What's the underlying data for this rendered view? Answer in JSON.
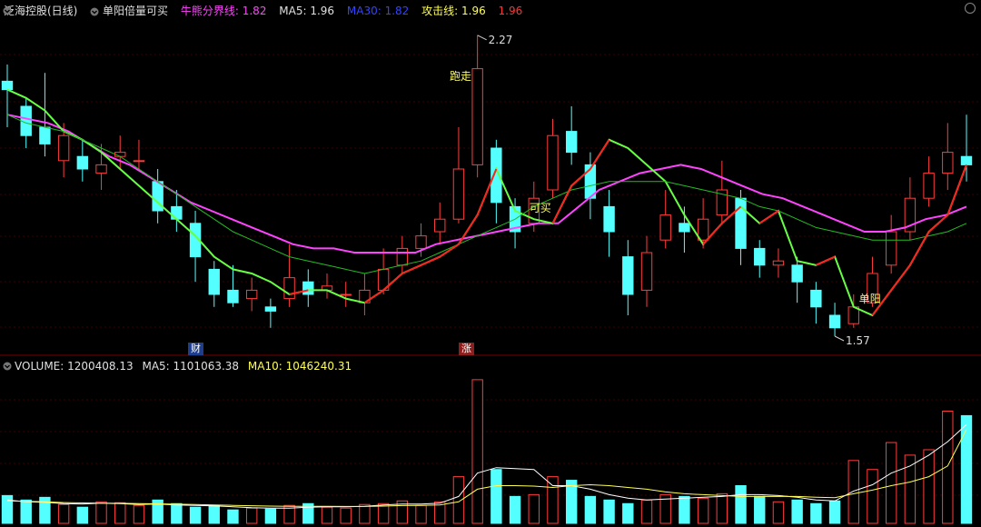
{
  "top_header": {
    "stock_name": "泛海控股(日线)",
    "indicator_name": "单阳倍量可买",
    "line1_label": "牛熊分界线: 1.82",
    "line2_label": "MA5: 1.96",
    "line3_label": "MA30: 1.82",
    "line4_label": "攻击线: 1.96",
    "line5_label": "1.96",
    "colors": {
      "stock": "#e0e0e0",
      "indicator": "#e0e0e0",
      "line1": "#ff44ff",
      "line2": "#e0e0e0",
      "line3": "#3344ff",
      "line4": "#ffff55",
      "line5": "#ff3333"
    }
  },
  "volume_header": {
    "volume_label": "VOLUME: 1200408.13",
    "ma5_label": "MA5: 1101063.38",
    "ma10_label": "MA10: 1046240.31",
    "colors": {
      "volume": "#e0e0e0",
      "ma5": "#e0e0e0",
      "ma10": "#ffff55"
    }
  },
  "annotations": {
    "high_label": "2.27",
    "low_label": "1.57",
    "signal_run": "跑走",
    "signal_buy": "可买",
    "signal_single": "单阳",
    "badge_cai": "财",
    "badge_zhang": "涨"
  },
  "chart_data": {
    "type": "candlestick",
    "price_range": [
      1.55,
      2.3
    ],
    "volume_range": [
      0,
      1700000
    ],
    "series": [
      {
        "name": "牛熊分界线",
        "values": [
          2.08,
          2.07,
          2.06,
          2.04,
          2.01,
          1.98,
          1.96,
          1.93,
          1.9,
          1.87,
          1.85,
          1.83,
          1.81,
          1.79,
          1.77,
          1.76,
          1.76,
          1.75,
          1.75,
          1.75,
          1.75,
          1.77,
          1.78,
          1.79,
          1.8,
          1.81,
          1.82,
          1.82,
          1.86,
          1.9,
          1.92,
          1.94,
          1.95,
          1.96,
          1.95,
          1.93,
          1.91,
          1.89,
          1.88,
          1.86,
          1.84,
          1.82,
          1.8,
          1.8,
          1.81,
          1.83,
          1.84,
          1.86
        ]
      },
      {
        "name": "MA5",
        "values": [
          2.14,
          2.12,
          2.09,
          2.04,
          2.02,
          1.99,
          1.95,
          1.91,
          1.87,
          1.83,
          1.79,
          1.74,
          1.71,
          1.7,
          1.68,
          1.65,
          1.66,
          1.66,
          1.64,
          1.63,
          1.66,
          1.7,
          1.72,
          1.74,
          1.77,
          1.84,
          1.95,
          1.85,
          1.83,
          1.82,
          1.91,
          1.95,
          2.02,
          2.0,
          1.96,
          1.92,
          1.84,
          1.77,
          1.82,
          1.86,
          1.82,
          1.85,
          1.73,
          1.72,
          1.74,
          1.62,
          1.6,
          1.66,
          1.72,
          1.8,
          1.84,
          1.96
        ]
      },
      {
        "name": "MA30",
        "values": [
          2.08,
          2.06,
          2.05,
          2.04,
          2.02,
          2.0,
          1.98,
          1.95,
          1.92,
          1.89,
          1.86,
          1.83,
          1.8,
          1.78,
          1.76,
          1.74,
          1.73,
          1.72,
          1.71,
          1.7,
          1.71,
          1.72,
          1.73,
          1.75,
          1.77,
          1.79,
          1.81,
          1.83,
          1.86,
          1.88,
          1.9,
          1.91,
          1.92,
          1.92,
          1.92,
          1.92,
          1.91,
          1.9,
          1.89,
          1.88,
          1.86,
          1.85,
          1.83,
          1.81,
          1.8,
          1.79,
          1.78,
          1.78,
          1.78,
          1.79,
          1.8,
          1.82
        ]
      }
    ],
    "candles": [
      [
        2.16,
        2.14,
        2.2,
        2.05
      ],
      [
        2.1,
        2.03,
        2.12,
        2.0
      ],
      [
        2.05,
        2.01,
        2.18,
        1.98
      ],
      [
        1.97,
        2.03,
        2.06,
        1.93
      ],
      [
        1.98,
        1.95,
        2.02,
        1.92
      ],
      [
        1.94,
        1.96,
        2.01,
        1.9
      ],
      [
        1.98,
        1.99,
        2.03,
        1.95
      ],
      [
        1.97,
        1.97,
        2.02,
        1.95
      ],
      [
        1.92,
        1.85,
        1.95,
        1.82
      ],
      [
        1.86,
        1.83,
        1.9,
        1.8
      ],
      [
        1.82,
        1.74,
        1.85,
        1.68
      ],
      [
        1.71,
        1.65,
        1.73,
        1.62
      ],
      [
        1.66,
        1.63,
        1.72,
        1.62
      ],
      [
        1.64,
        1.66,
        1.69,
        1.61
      ],
      [
        1.62,
        1.61,
        1.64,
        1.57
      ],
      [
        1.64,
        1.69,
        1.77,
        1.62
      ],
      [
        1.68,
        1.65,
        1.71,
        1.62
      ],
      [
        1.66,
        1.67,
        1.7,
        1.64
      ],
      [
        1.65,
        1.65,
        1.68,
        1.62
      ],
      [
        1.63,
        1.66,
        1.7,
        1.6
      ],
      [
        1.66,
        1.71,
        1.76,
        1.65
      ],
      [
        1.72,
        1.76,
        1.79,
        1.7
      ],
      [
        1.76,
        1.79,
        1.82,
        1.74
      ],
      [
        1.8,
        1.83,
        1.87,
        1.77
      ],
      [
        1.83,
        1.95,
        2.05,
        1.82
      ],
      [
        1.96,
        2.19,
        2.27,
        1.93
      ],
      [
        2.0,
        1.87,
        2.02,
        1.82
      ],
      [
        1.86,
        1.8,
        1.88,
        1.76
      ],
      [
        1.82,
        1.88,
        1.92,
        1.8
      ],
      [
        1.9,
        2.03,
        2.07,
        1.88
      ],
      [
        2.04,
        1.99,
        2.1,
        1.96
      ],
      [
        1.96,
        1.88,
        1.99,
        1.83
      ],
      [
        1.86,
        1.8,
        1.9,
        1.74
      ],
      [
        1.74,
        1.65,
        1.78,
        1.6
      ],
      [
        1.66,
        1.75,
        1.79,
        1.62
      ],
      [
        1.78,
        1.84,
        1.9,
        1.76
      ],
      [
        1.82,
        1.8,
        1.86,
        1.75
      ],
      [
        1.78,
        1.83,
        1.88,
        1.76
      ],
      [
        1.84,
        1.9,
        1.97,
        1.82
      ],
      [
        1.88,
        1.76,
        1.9,
        1.72
      ],
      [
        1.76,
        1.72,
        1.78,
        1.69
      ],
      [
        1.72,
        1.73,
        1.76,
        1.69
      ],
      [
        1.72,
        1.68,
        1.74,
        1.63
      ],
      [
        1.66,
        1.62,
        1.68,
        1.58
      ],
      [
        1.6,
        1.57,
        1.63,
        1.55
      ],
      [
        1.58,
        1.62,
        1.65,
        1.57
      ],
      [
        1.63,
        1.7,
        1.74,
        1.62
      ],
      [
        1.72,
        1.8,
        1.84,
        1.7
      ],
      [
        1.8,
        1.88,
        1.93,
        1.78
      ],
      [
        1.88,
        1.94,
        1.98,
        1.86
      ],
      [
        1.94,
        1.99,
        2.06,
        1.9
      ],
      [
        1.98,
        1.96,
        2.08,
        1.92
      ]
    ],
    "volume": [
      310000,
      260000,
      290000,
      210000,
      180000,
      240000,
      230000,
      200000,
      260000,
      220000,
      180000,
      200000,
      150000,
      170000,
      160000,
      200000,
      220000,
      180000,
      170000,
      210000,
      220000,
      250000,
      200000,
      240000,
      520000,
      1600000,
      600000,
      300000,
      320000,
      520000,
      480000,
      300000,
      260000,
      220000,
      260000,
      320000,
      300000,
      280000,
      330000,
      420000,
      300000,
      240000,
      260000,
      220000,
      250000,
      700000,
      600000,
      900000,
      760000,
      820000,
      1250000,
      1200000
    ],
    "volume_ma5": [
      260000,
      240000,
      235000,
      220000,
      215000,
      225000,
      220000,
      210000,
      215000,
      205000,
      200000,
      195000,
      185000,
      175000,
      170000,
      170000,
      180000,
      185000,
      185000,
      190000,
      205000,
      215000,
      215000,
      225000,
      300000,
      560000,
      620000,
      610000,
      600000,
      420000,
      420000,
      380000,
      320000,
      280000,
      260000,
      270000,
      280000,
      290000,
      300000,
      320000,
      320000,
      310000,
      290000,
      260000,
      250000,
      360000,
      430000,
      560000,
      640000,
      760000,
      910000,
      1101063
    ],
    "volume_ma10": [
      250000,
      245000,
      240000,
      232000,
      228000,
      226000,
      224000,
      220000,
      218000,
      214000,
      210000,
      205000,
      200000,
      196000,
      192000,
      190000,
      190000,
      190000,
      188000,
      188000,
      192000,
      198000,
      200000,
      205000,
      240000,
      380000,
      420000,
      420000,
      415000,
      400000,
      420000,
      430000,
      420000,
      400000,
      380000,
      350000,
      330000,
      320000,
      310000,
      300000,
      300000,
      300000,
      300000,
      290000,
      285000,
      330000,
      370000,
      420000,
      460000,
      520000,
      640000,
      1046240
    ]
  }
}
